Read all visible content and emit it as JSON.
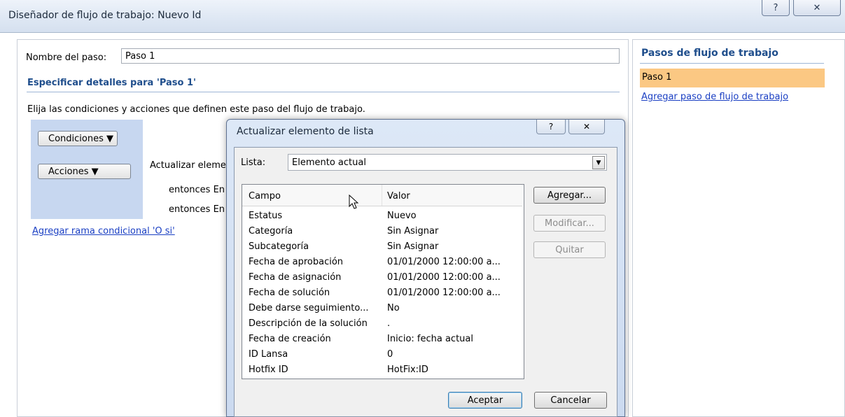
{
  "window": {
    "title": "Diseñador de flujo de trabajo: Nuevo Id",
    "help_glyph": "?",
    "close_glyph": "✕"
  },
  "step": {
    "name_label": "Nombre del paso:",
    "name_value": "Paso 1"
  },
  "details": {
    "heading": "Especificar detalles para 'Paso 1'",
    "instructions": "Elija las condiciones y acciones que definen este paso del flujo de trabajo.",
    "conditions_btn": "Condiciones ▼",
    "actions_btn": "Acciones ▼",
    "action_lines": [
      "Actualizar eleme",
      "entonces En",
      "entonces En"
    ],
    "add_branch_link": "Agregar rama condicional 'O si'"
  },
  "sidebar": {
    "heading": "Pasos de flujo de trabajo",
    "steps": [
      "Paso 1"
    ],
    "add_step_link": "Agregar paso de flujo de trabajo"
  },
  "dialog": {
    "title": "Actualizar elemento de lista",
    "help_glyph": "?",
    "close_glyph": "✕",
    "list_label": "Lista:",
    "list_value": "Elemento actual",
    "columns": [
      "Campo",
      "Valor"
    ],
    "rows": [
      {
        "field": "Estatus",
        "value": "Nuevo"
      },
      {
        "field": "Categoría",
        "value": "Sin Asignar"
      },
      {
        "field": "Subcategoría",
        "value": "Sin Asignar"
      },
      {
        "field": "Fecha de aprobación",
        "value": "01/01/2000 12:00:00 a..."
      },
      {
        "field": "Fecha de asignación",
        "value": "01/01/2000 12:00:00 a..."
      },
      {
        "field": "Fecha de solución",
        "value": "01/01/2000 12:00:00 a..."
      },
      {
        "field": "Debe darse seguimiento...",
        "value": "No"
      },
      {
        "field": "Descripción de la solución",
        "value": "."
      },
      {
        "field": "Fecha de creación",
        "value": "Inicio: fecha actual"
      },
      {
        "field": "ID Lansa",
        "value": "0"
      },
      {
        "field": "Hotfix ID",
        "value": "HotFix:ID"
      }
    ],
    "add_btn": "Agregar...",
    "modify_btn": "Modificar...",
    "remove_btn": "Quitar",
    "ok_btn": "Aceptar",
    "cancel_btn": "Cancelar"
  }
}
